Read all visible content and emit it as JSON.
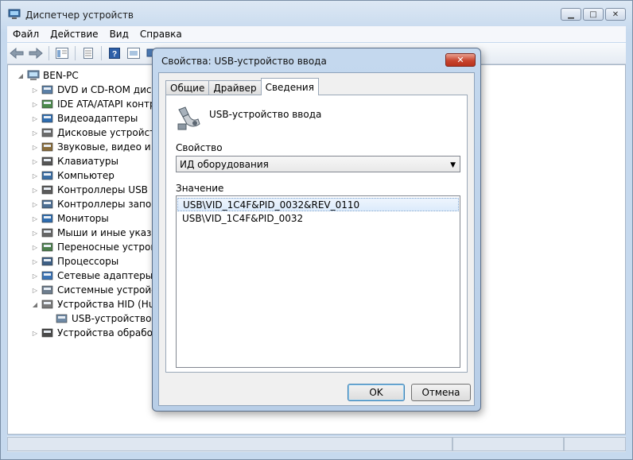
{
  "window": {
    "title": "Диспетчер устройств",
    "controls": {
      "minimize": "▁",
      "maximize": "□",
      "close": "✕"
    }
  },
  "menu": [
    "Файл",
    "Действие",
    "Вид",
    "Справка"
  ],
  "tree": {
    "root": "BEN-PC",
    "items": [
      {
        "label": "DVD и CD-ROM диско",
        "icon": "dvd-icon"
      },
      {
        "label": "IDE ATA/ATAPI контро",
        "icon": "ide-controller-icon"
      },
      {
        "label": "Видеоадаптеры",
        "icon": "display-adapter-icon"
      },
      {
        "label": "Дисковые устройства",
        "icon": "disk-drive-icon"
      },
      {
        "label": "Звуковые, видео и игр",
        "icon": "sound-icon"
      },
      {
        "label": "Клавиатуры",
        "icon": "keyboard-icon"
      },
      {
        "label": "Компьютер",
        "icon": "computer-icon"
      },
      {
        "label": "Контроллеры USB",
        "icon": "usb-controller-icon"
      },
      {
        "label": "Контроллеры запоми",
        "icon": "storage-controller-icon"
      },
      {
        "label": "Мониторы",
        "icon": "monitor-icon"
      },
      {
        "label": "Мыши и иные указыв",
        "icon": "mouse-icon"
      },
      {
        "label": "Переносные устройст",
        "icon": "portable-device-icon"
      },
      {
        "label": "Процессоры",
        "icon": "processor-icon"
      },
      {
        "label": "Сетевые адаптеры",
        "icon": "network-adapter-icon"
      },
      {
        "label": "Системные устройств",
        "icon": "system-device-icon"
      },
      {
        "label": "Устройства HID (Hum",
        "icon": "hid-icon",
        "expanded": true
      },
      {
        "label": "USB-устройство вв",
        "icon": "usb-input-device-icon",
        "child": true
      },
      {
        "label": "Устройства обработк",
        "icon": "imaging-device-icon"
      }
    ]
  },
  "dialog": {
    "title": "Свойства: USB-устройство ввода",
    "close_label": "✕",
    "tabs": [
      "Общие",
      "Драйвер",
      "Сведения"
    ],
    "active_tab": "Сведения",
    "device_name": "USB-устройство ввода",
    "property_label": "Свойство",
    "property_value": "ИД оборудования",
    "value_label": "Значение",
    "values": [
      "USB\\VID_1C4F&PID_0032&REV_0110",
      "USB\\VID_1C4F&PID_0032"
    ],
    "ok_label": "OK",
    "cancel_label": "Отмена"
  }
}
